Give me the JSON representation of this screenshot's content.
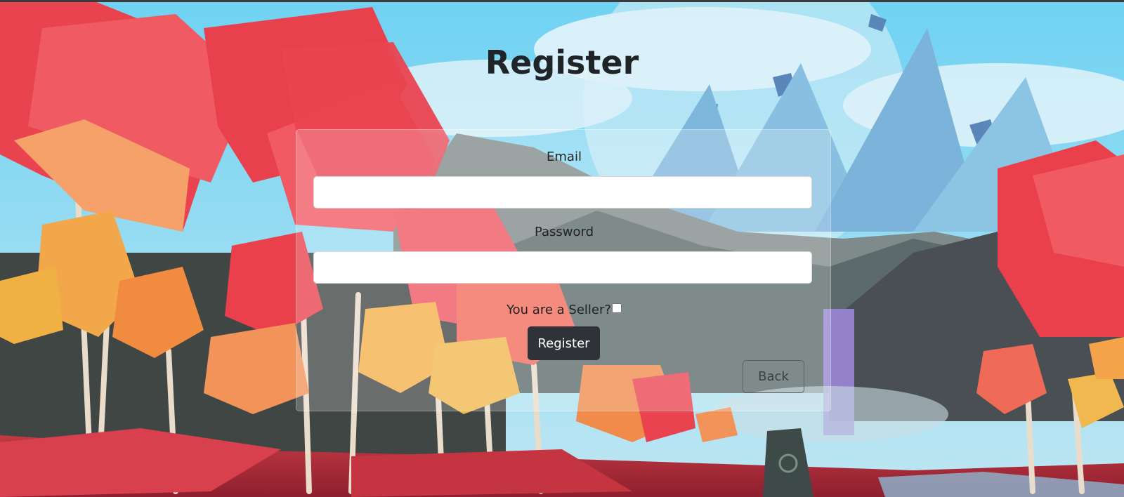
{
  "page": {
    "title": "Register"
  },
  "form": {
    "email_label": "Email",
    "email_value": "",
    "password_label": "Password",
    "password_value": "",
    "seller_label": "You are a Seller?",
    "seller_checked": false,
    "register_label": "Register",
    "back_label": "Back"
  },
  "colors": {
    "register_button_bg": "#2f3338",
    "title_text": "#1f2428",
    "card_overlay": "rgba(255,255,255,0.22)"
  }
}
